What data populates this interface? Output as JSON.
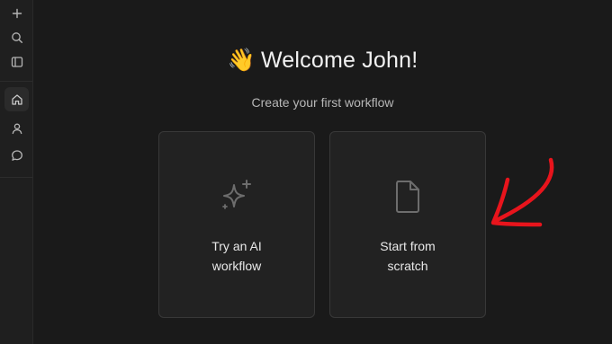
{
  "sidebar": {
    "icons": [
      "plus-icon",
      "search-icon",
      "sidebar-toggle-icon",
      "home-icon",
      "user-icon",
      "chat-icon"
    ],
    "active": "home-icon"
  },
  "main": {
    "greeting_emoji": "👋",
    "greeting": "Welcome John!",
    "subtitle": "Create your first workflow",
    "cards": [
      {
        "label_line1": "Try an AI",
        "label_line2": "workflow",
        "icon": "sparkle-icon"
      },
      {
        "label_line1": "Start from",
        "label_line2": "scratch",
        "icon": "document-icon"
      }
    ]
  },
  "annotation": {
    "type": "hand-drawn-arrow",
    "color": "#e8141c",
    "points_to": "start-from-scratch-card"
  },
  "colors": {
    "background": "#1a1a1a",
    "card": "#222222",
    "card_border": "#383838",
    "text": "#f1f1f1"
  }
}
